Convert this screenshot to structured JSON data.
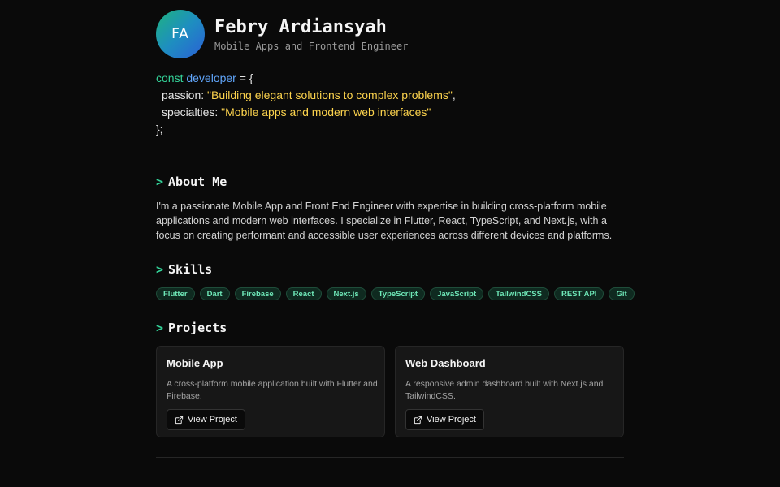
{
  "profile": {
    "initials": "FA",
    "name": "Febry Ardiansyah",
    "role": "Mobile Apps and Frontend Engineer"
  },
  "code": {
    "keyword": "const",
    "variable": "developer",
    "open": " = {",
    "passion_key": "passion: ",
    "passion_value": "\"Building elegant solutions to complex problems\"",
    "passion_comma": ",",
    "specialties_key": "specialties: ",
    "specialties_value": "\"Mobile apps and modern web interfaces\"",
    "close": "};"
  },
  "about": {
    "prompt": ">",
    "title": "About Me",
    "text": "I'm a passionate Mobile App and Front End Engineer with expertise in building cross-platform mobile applications and modern web interfaces. I specialize in Flutter, React, TypeScript, and Next.js, with a focus on creating performant and accessible user experiences across different devices and platforms."
  },
  "skills": {
    "prompt": ">",
    "title": "Skills",
    "items": [
      "Flutter",
      "Dart",
      "Firebase",
      "React",
      "Next.js",
      "TypeScript",
      "JavaScript",
      "TailwindCSS",
      "REST API",
      "Git"
    ]
  },
  "projects": {
    "prompt": ">",
    "title": "Projects",
    "items": [
      {
        "title": "Mobile App",
        "description": "A cross-platform mobile application built with Flutter and Firebase.",
        "button_label": "View Project",
        "button_icon": "external-link-icon"
      },
      {
        "title": "Web Dashboard",
        "description": "A responsive admin dashboard built with Next.js and TailwindCSS.",
        "button_label": "View Project",
        "button_icon": "external-link-icon"
      }
    ]
  },
  "colors": {
    "background": "#0a0a0a",
    "accent_green": "#34d399",
    "keyword_green": "#34d399",
    "variable_blue": "#60a5fa",
    "string_yellow": "#fcd34d"
  }
}
